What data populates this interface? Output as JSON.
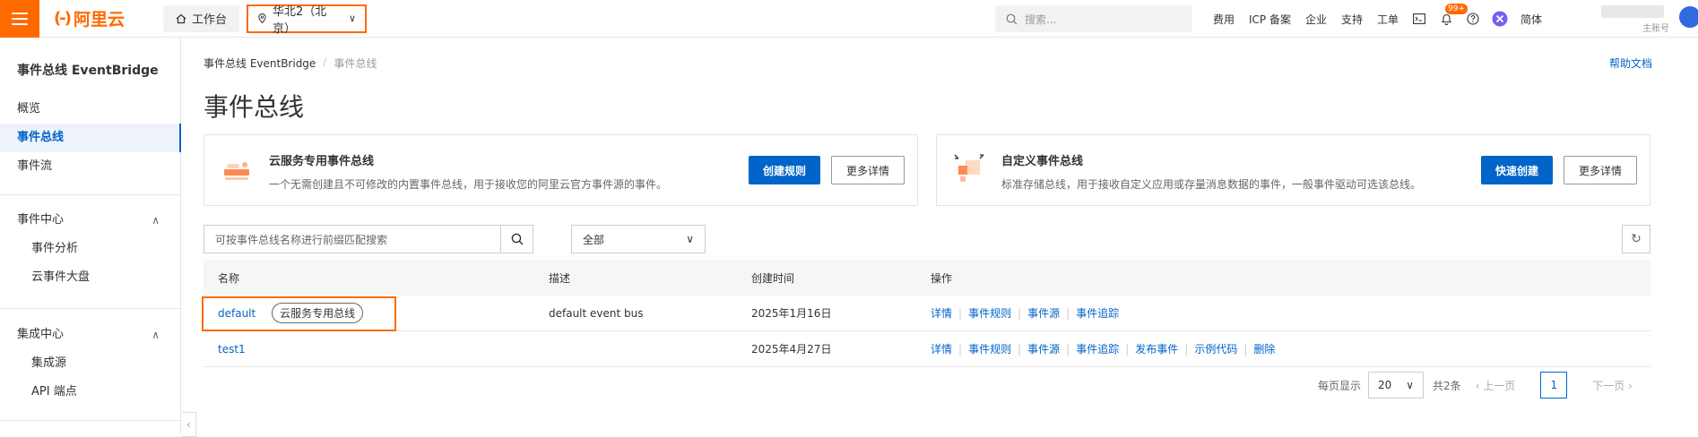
{
  "topbar": {
    "logo_text": "阿里云",
    "logo_mark": "(-)",
    "workbench_label": "工作台",
    "region_label": "华北2（北京）",
    "search_placeholder": "搜索...",
    "links": [
      "费用",
      "ICP 备案",
      "企业",
      "支持",
      "工单"
    ],
    "notification_badge": "99+",
    "language": "简体",
    "account_sub": "主账号",
    "accent_color": "#ff6a00"
  },
  "sidebar": {
    "title": "事件总线 EventBridge",
    "items": [
      {
        "label": "概览"
      },
      {
        "label": "事件总线",
        "active": true
      },
      {
        "label": "事件流"
      }
    ],
    "group1": {
      "label": "事件中心",
      "items": [
        "事件分析",
        "云事件大盘"
      ]
    },
    "group2": {
      "label": "集成中心",
      "items": [
        "集成源",
        "API 端点"
      ]
    }
  },
  "breadcrumb": [
    "事件总线 EventBridge",
    "事件总线"
  ],
  "help_link": "帮助文档",
  "page_title": "事件总线",
  "cards": [
    {
      "title": "云服务专用事件总线",
      "desc": "一个无需创建且不可修改的内置事件总线，用于接收您的阿里云官方事件源的事件。",
      "primary": "创建规则",
      "secondary": "更多详情"
    },
    {
      "title": "自定义事件总线",
      "desc": "标准存储总线，用于接收自定义应用或存量消息数据的事件，一般事件驱动可选该总线。",
      "primary": "快速创建",
      "secondary": "更多详情"
    }
  ],
  "search": {
    "placeholder": "可按事件总线名称进行前缀匹配搜索"
  },
  "filter": {
    "selected": "全部"
  },
  "table": {
    "headers": [
      "名称",
      "描述",
      "创建时间",
      "操作"
    ],
    "rows": [
      {
        "name": "default",
        "tag": "云服务专用总线",
        "desc": "default event bus",
        "created": "2025年1月16日",
        "ops": [
          "详情",
          "事件规则",
          "事件源",
          "事件追踪"
        ]
      },
      {
        "name": "test1",
        "tag": "",
        "desc": "",
        "created": "2025年4月27日",
        "ops": [
          "详情",
          "事件规则",
          "事件源",
          "事件追踪",
          "发布事件",
          "示例代码",
          "删除"
        ]
      }
    ]
  },
  "pager": {
    "per_page_label": "每页显示",
    "per_page": "20",
    "total": "共2条",
    "prev": "上一页",
    "current": "1",
    "next": "下一页"
  },
  "colors": {
    "primary": "#0064c8",
    "accent": "#ff6a00"
  }
}
